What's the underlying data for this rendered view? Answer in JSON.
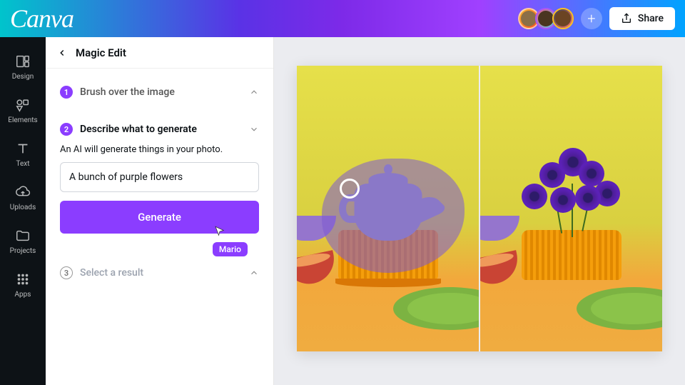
{
  "header": {
    "logo": "Canva",
    "share_label": "Share",
    "collaborator_tag": "Mario"
  },
  "rail": {
    "items": [
      {
        "icon": "design",
        "label": "Design"
      },
      {
        "icon": "elements",
        "label": "Elements"
      },
      {
        "icon": "text",
        "label": "Text"
      },
      {
        "icon": "uploads",
        "label": "Uploads"
      },
      {
        "icon": "projects",
        "label": "Projects"
      },
      {
        "icon": "apps",
        "label": "Apps"
      }
    ]
  },
  "panel": {
    "title": "Magic Edit",
    "steps": [
      {
        "num": "1",
        "label": "Brush over the image",
        "state": "done"
      },
      {
        "num": "2",
        "label": "Describe what to generate",
        "state": "active"
      },
      {
        "num": "3",
        "label": "Select a result",
        "state": "upcoming"
      }
    ],
    "describe_hint": "An AI will generate things in your photo.",
    "prompt_value": "A bunch of purple flowers",
    "generate_label": "Generate"
  },
  "colors": {
    "accent": "#8b3dff",
    "rail_bg": "#0d1216"
  }
}
